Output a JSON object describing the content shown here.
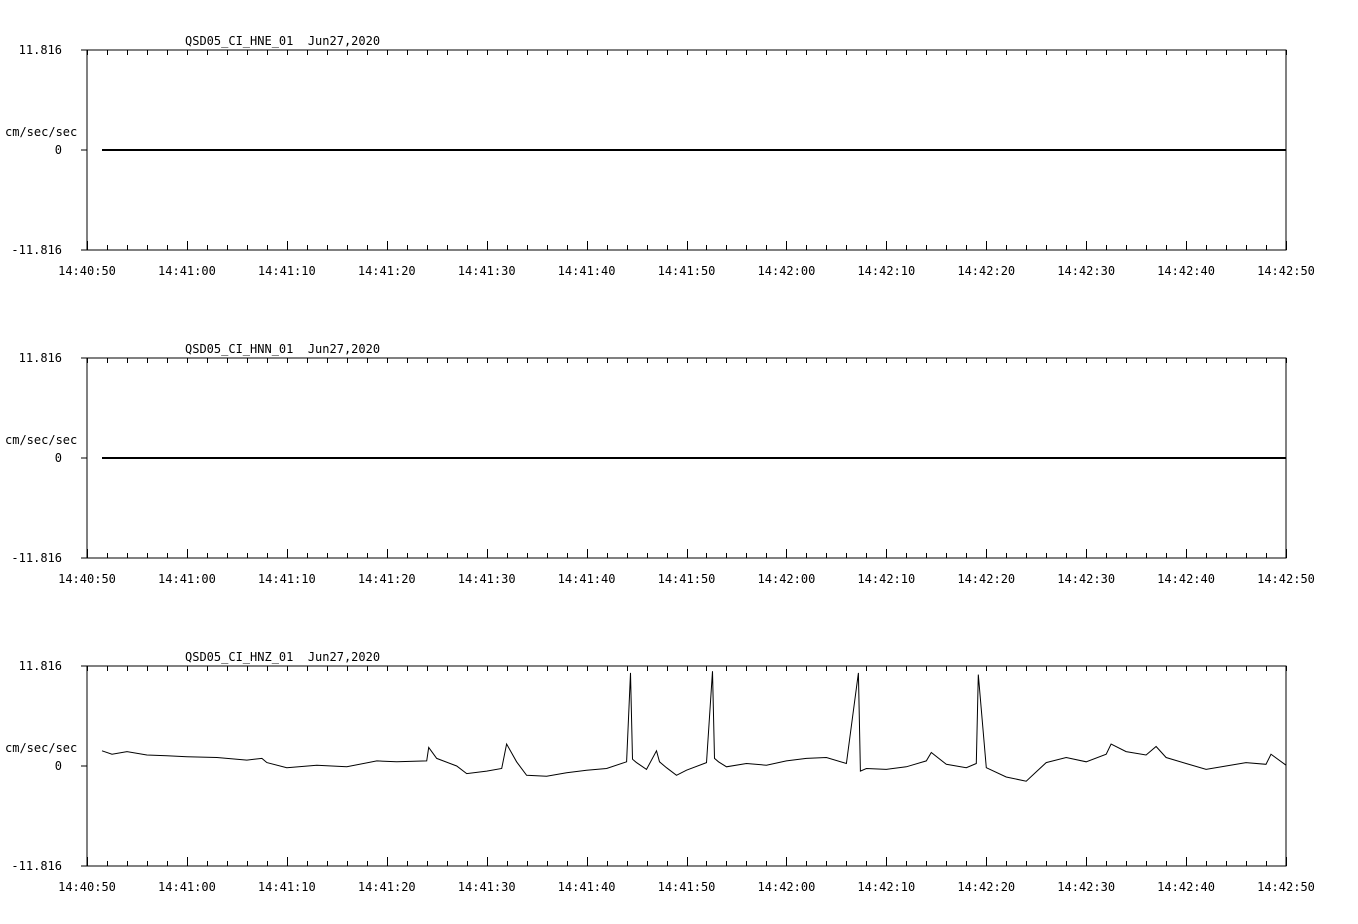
{
  "chart_data": [
    {
      "type": "line",
      "title": "QSD05_CI_HNE_01  Jun27,2020",
      "ylabel": "cm/sec/sec",
      "ylim": [
        -11.816,
        11.816
      ],
      "y_tick_labels": [
        "11.816",
        "0",
        "-11.816"
      ],
      "x_tick_labels": [
        "14:40:50",
        "14:41:00",
        "14:41:10",
        "14:41:20",
        "14:41:30",
        "14:41:40",
        "14:41:50",
        "14:42:00",
        "14:42:10",
        "14:42:20",
        "14:42:30",
        "14:42:40",
        "14:42:50"
      ],
      "xlim": [
        "14:40:50",
        "14:42:50"
      ],
      "series": [
        {
          "x": [
            "14:40:51.5",
            "14:42:50"
          ],
          "values": [
            0,
            0
          ]
        }
      ]
    },
    {
      "type": "line",
      "title": "QSD05_CI_HNN_01  Jun27,2020",
      "ylabel": "cm/sec/sec",
      "ylim": [
        -11.816,
        11.816
      ],
      "y_tick_labels": [
        "11.816",
        "0",
        "-11.816"
      ],
      "x_tick_labels": [
        "14:40:50",
        "14:41:00",
        "14:41:10",
        "14:41:20",
        "14:41:30",
        "14:41:40",
        "14:41:50",
        "14:42:00",
        "14:42:10",
        "14:42:20",
        "14:42:30",
        "14:42:40",
        "14:42:50"
      ],
      "xlim": [
        "14:40:50",
        "14:42:50"
      ],
      "series": [
        {
          "x": [
            "14:40:51.5",
            "14:42:50"
          ],
          "values": [
            0,
            0
          ]
        }
      ]
    },
    {
      "type": "line",
      "title": "QSD05_CI_HNZ_01  Jun27,2020",
      "ylabel": "cm/sec/sec",
      "ylim": [
        -11.816,
        11.816
      ],
      "y_tick_labels": [
        "11.816",
        "0",
        "-11.816"
      ],
      "x_tick_labels": [
        "14:40:50",
        "14:41:00",
        "14:41:10",
        "14:41:20",
        "14:41:30",
        "14:41:40",
        "14:41:50",
        "14:42:00",
        "14:42:10",
        "14:42:20",
        "14:42:30",
        "14:42:40",
        "14:42:50"
      ],
      "xlim": [
        "14:40:50",
        "14:42:50"
      ],
      "series": [
        {
          "x": [
            "14:40:51.5",
            "14:40:52.5",
            "14:40:54",
            "14:40:56",
            "14:40:58",
            "14:41:00",
            "14:41:03",
            "14:41:06",
            "14:41:07.5",
            "14:41:08",
            "14:41:10",
            "14:41:13",
            "14:41:16",
            "14:41:19",
            "14:41:21",
            "14:41:24",
            "14:41:24.2",
            "14:41:25",
            "14:41:27",
            "14:41:28",
            "14:41:30",
            "14:41:31.5",
            "14:41:32",
            "14:41:33",
            "14:41:34",
            "14:41:36",
            "14:41:38",
            "14:41:40",
            "14:41:42",
            "14:41:44",
            "14:41:44.4",
            "14:41:44.6",
            "14:41:45",
            "14:41:46",
            "14:41:47",
            "14:41:47.3",
            "14:41:48",
            "14:41:49",
            "14:41:50",
            "14:41:52",
            "14:41:52.6",
            "14:41:52.8",
            "14:41:53.2",
            "14:41:54",
            "14:41:56",
            "14:41:58",
            "14:42:00",
            "14:42:02",
            "14:42:04",
            "14:42:06",
            "14:42:07.2",
            "14:42:07.4",
            "14:42:08",
            "14:42:10",
            "14:42:12",
            "14:42:14",
            "14:42:14.5",
            "14:42:16",
            "14:42:18",
            "14:42:19",
            "14:42:19.2",
            "14:42:20",
            "14:42:22",
            "14:42:24",
            "14:42:25",
            "14:42:26",
            "14:42:28",
            "14:42:30",
            "14:42:32",
            "14:42:32.5",
            "14:42:34",
            "14:42:36",
            "14:42:37",
            "14:42:38",
            "14:42:40",
            "14:42:42",
            "14:42:44",
            "14:42:46",
            "14:42:48",
            "14:42:48.5",
            "14:42:50"
          ],
          "values": [
            1.8,
            1.4,
            1.7,
            1.3,
            1.2,
            1.1,
            1.0,
            0.7,
            0.9,
            0.4,
            -0.2,
            0.1,
            -0.1,
            0.6,
            0.5,
            0.6,
            2.2,
            0.9,
            0.0,
            -0.9,
            -0.6,
            -0.3,
            2.6,
            0.5,
            -1.1,
            -1.2,
            -0.8,
            -0.5,
            -0.3,
            0.5,
            11.0,
            0.8,
            0.4,
            -0.4,
            1.8,
            0.5,
            -0.2,
            -1.1,
            -0.5,
            0.4,
            11.2,
            0.9,
            0.5,
            -0.1,
            0.3,
            0.1,
            0.6,
            0.9,
            1.0,
            0.3,
            11.0,
            -0.6,
            -0.3,
            -0.4,
            -0.1,
            0.6,
            1.6,
            0.2,
            -0.2,
            0.3,
            10.8,
            -0.2,
            -1.3,
            -1.8,
            -0.7,
            0.4,
            1.0,
            0.5,
            1.4,
            2.6,
            1.7,
            1.3,
            2.3,
            1.0,
            0.3,
            -0.4,
            0.0,
            0.4,
            0.2,
            1.4,
            0.1
          ]
        }
      ]
    }
  ]
}
